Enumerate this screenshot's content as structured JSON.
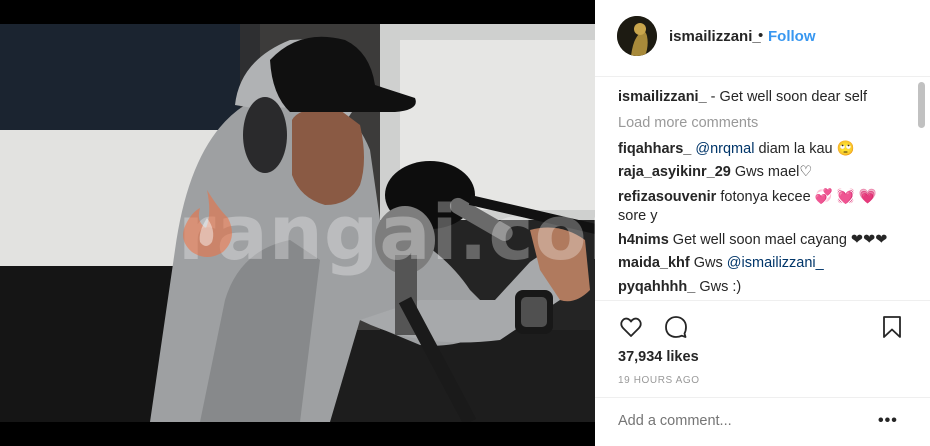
{
  "post": {
    "username": "ismailizzani_",
    "follow_dot": "•",
    "follow_label": "Follow"
  },
  "caption": {
    "username": "ismailizzani_",
    "text": " - Get well soon dear self"
  },
  "load_more_label": "Load more comments",
  "comments": [
    {
      "user": "fiqahhars_",
      "mention": "@nrqmal",
      "text": " diam la kau 🙄"
    },
    {
      "user": "raja_asyikinr_29",
      "text": " Gws mael♡"
    },
    {
      "user": "refizasouvenir",
      "text": " fotonya kecee 💞 💓 💗",
      "text2": "sore y"
    },
    {
      "user": "h4nims",
      "text": " Get well soon mael cayang ❤❤❤"
    },
    {
      "user": "maida_khf",
      "text": " Gws ",
      "mention": "@ismailizzani_"
    },
    {
      "user": "pyqahhhh_",
      "text": " Gws :)"
    }
  ],
  "likes_text": "37,934 likes",
  "timestamp": "19 HOURS AGO",
  "add_comment_placeholder": "Add a comment...",
  "more_options_label": "•••",
  "watermark_text": "rangai.com",
  "icons": {
    "like": "heart-outline-icon",
    "comment": "speech-bubble-icon",
    "save": "bookmark-icon"
  },
  "colors": {
    "link_blue": "#3897f0",
    "mention_blue": "#003569",
    "muted_gray": "#999999",
    "text": "#262626"
  }
}
